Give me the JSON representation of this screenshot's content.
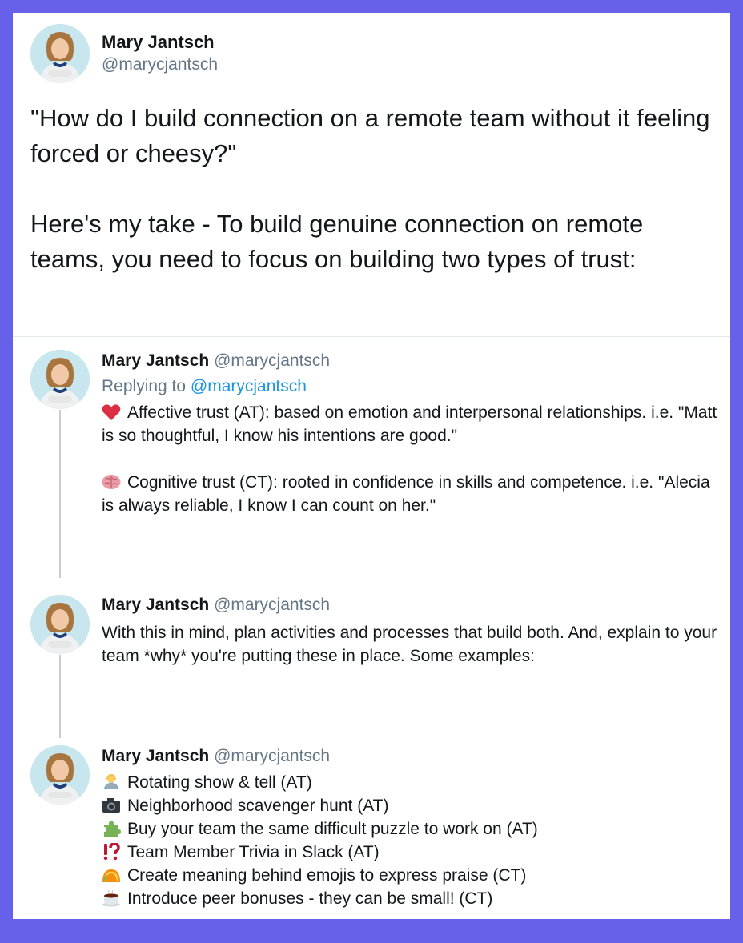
{
  "main_tweet": {
    "name": "Mary Jantsch",
    "handle": "@marycjantsch",
    "text": "\"How do I build connection on a remote team without it feeling forced or cheesy?\"\n\nHere's my take - To build genuine connection on remote teams, you need to focus on building two types of trust:"
  },
  "replies": [
    {
      "name": "Mary Jantsch",
      "handle": "@marycjantsch",
      "replying_prefix": "Replying to",
      "replying_to": "@marycjantsch",
      "items": [
        {
          "icon": "heart-icon",
          "text": "Affective trust (AT): based on emotion and interpersonal relationships. i.e. \"Matt is so thoughtful, I know his intentions are good.\""
        },
        {
          "icon": "brain-icon",
          "text": "Cognitive trust (CT): rooted in confidence in skills and competence. i.e. \"Alecia is always reliable, I know I can count on her.\""
        }
      ]
    },
    {
      "name": "Mary Jantsch",
      "handle": "@marycjantsch",
      "text": "With this in mind, plan activities and processes that build both. And, explain to your team *why* you're putting these in place. Some examples:"
    },
    {
      "name": "Mary Jantsch",
      "handle": "@marycjantsch",
      "list": [
        {
          "icon": "person-laptop-icon",
          "text": "Rotating show & tell (AT)"
        },
        {
          "icon": "camera-icon",
          "text": "Neighborhood scavenger hunt (AT)"
        },
        {
          "icon": "puzzle-piece-icon",
          "text": "Buy your team the same difficult puzzle to work on (AT)"
        },
        {
          "icon": "interrobang-icon",
          "text": "Team Member Trivia in Slack (AT)"
        },
        {
          "icon": "taco-icon",
          "text": "Create meaning behind emojis to express praise (CT)"
        },
        {
          "icon": "coffee-icon",
          "text": "Introduce peer bonuses - they can be small! (CT)"
        }
      ]
    }
  ],
  "colors": {
    "border": "#6661e8",
    "link": "#1b95e0",
    "muted": "#657786"
  }
}
